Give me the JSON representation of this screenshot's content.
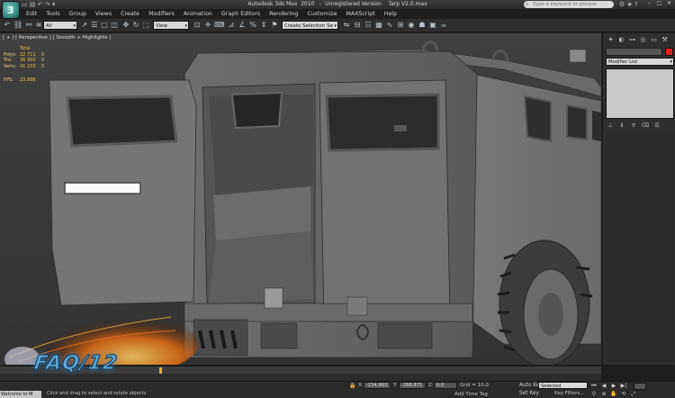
{
  "app": {
    "title": "Autodesk 3ds Max  2010   -  Unregistered Version    Tarp V2.0.max",
    "logo_letter": "3",
    "search_placeholder": "Type a keyword or phrase"
  },
  "menu": [
    "Edit",
    "Tools",
    "Group",
    "Views",
    "Create",
    "Modifiers",
    "Animation",
    "Graph Editors",
    "Rendering",
    "Customize",
    "MAXScript",
    "Help"
  ],
  "toolbar": {
    "selection_filter": "All",
    "reference_coord": "View",
    "named_selection": "Create Selection Se"
  },
  "viewport": {
    "label": "[ + ] [ Perspective ] [ Smooth + Highlights ]",
    "stats": {
      "total_label": "Total",
      "rows": [
        {
          "label": "Polys:",
          "value": "22 711",
          "sel": "0"
        },
        {
          "label": "Tris:",
          "value": "36 450",
          "sel": "0"
        },
        {
          "label": "Verts:",
          "value": "41 233",
          "sel": "0"
        }
      ],
      "fps_label": "FPS:",
      "fps_value": "23,898"
    },
    "overlay_logo": "FAQ/12"
  },
  "command_panel": {
    "modifier_list": "Modifier List",
    "object_color": "#e02020"
  },
  "status": {
    "listener_text": "Welcome to M",
    "prompt": "Click and drag to select and rotate objects",
    "x_label": "X:",
    "x_value": "-234,963",
    "y_label": "Y:",
    "y_value": "-268,871",
    "z_label": "Z:",
    "z_value": "0,0",
    "grid": "Grid = 10,0",
    "add_time_tag": "Add Time Tag",
    "auto_key": "Auto Key",
    "set_key": "Set Key",
    "selected": "Selected",
    "key_filters": "Key Filters..."
  },
  "timeline": {
    "position_fraction": 0.265
  }
}
